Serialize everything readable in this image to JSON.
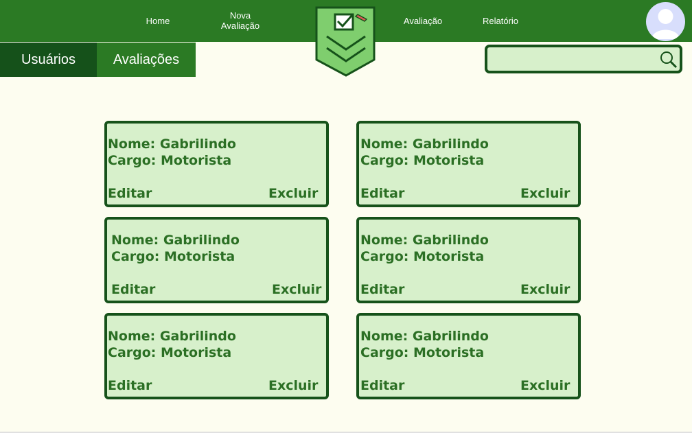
{
  "colors": {
    "header_green": "#2b7a24",
    "dark_green": "#16521a",
    "card_fill": "#d7f0cb",
    "card_text": "#2b6f24",
    "background": "#fdfdf0",
    "avatar_bg": "#d8defc"
  },
  "header": {
    "nav": [
      {
        "label": "Home"
      },
      {
        "label_line1": "Nova",
        "label_line2": "Avaliação"
      },
      {
        "label": "Avaliação"
      },
      {
        "label": "Relatório"
      }
    ],
    "logo_icon": "checkbox-shield-logo",
    "avatar_icon": "user-avatar-icon"
  },
  "tabs": [
    {
      "label": "Usuários"
    },
    {
      "label": "Avaliações"
    }
  ],
  "search": {
    "value": "",
    "placeholder": "",
    "icon": "search-icon"
  },
  "cards": [
    {
      "name": "Nome: Gabrilindo",
      "cargo": "Cargo: Motorista",
      "edit": "Editar",
      "delete": "Excluir"
    },
    {
      "name": "Nome: Gabrilindo",
      "cargo": "Cargo: Motorista",
      "edit": "Editar",
      "delete": "Excluir"
    },
    {
      "name": "Nome: Gabrilindo",
      "cargo": "Cargo: Motorista",
      "edit": "Editar",
      "delete": "Excluir"
    },
    {
      "name": "Nome: Gabrilindo",
      "cargo": "Cargo: Motorista",
      "edit": "Editar",
      "delete": "Excluir"
    },
    {
      "name": "Nome: Gabrilindo",
      "cargo": "Cargo: Motorista",
      "edit": "Editar",
      "delete": "Excluir"
    },
    {
      "name": "Nome: Gabrilindo",
      "cargo": "Cargo: Motorista",
      "edit": "Editar",
      "delete": "Excluir"
    }
  ]
}
